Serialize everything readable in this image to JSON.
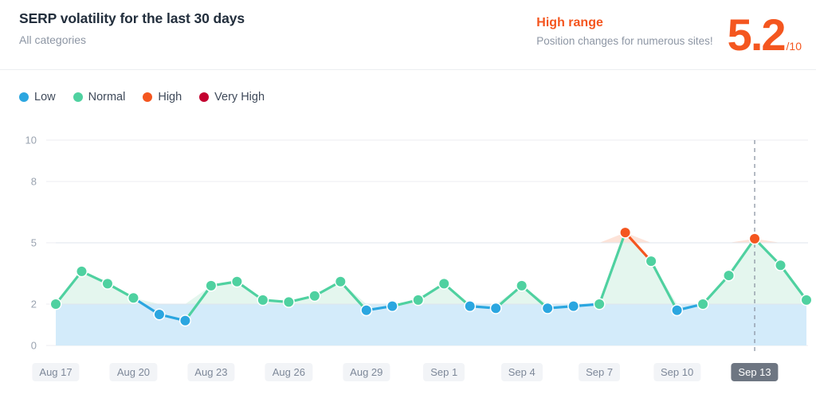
{
  "header": {
    "title": "SERP volatility for the last 30 days",
    "subtitle": "All categories",
    "range_title": "High range",
    "range_description": "Position changes for numerous sites!",
    "score_value": "5.2",
    "score_max": "/10"
  },
  "legend": [
    {
      "label": "Low",
      "color": "#2ba6e0"
    },
    {
      "label": "Normal",
      "color": "#4fd1a0"
    },
    {
      "label": "High",
      "color": "#f4561f"
    },
    {
      "label": "Very High",
      "color": "#c3002f"
    }
  ],
  "colors": {
    "low": "#2ba6e0",
    "normal": "#4fd1a0",
    "high": "#f4561f",
    "very_high": "#c3002f",
    "low_fill": "#d3ebfa",
    "normal_fill": "#e4f6ee",
    "high_fill": "#fde3d8",
    "grid": "#eceef1",
    "marker_line": "#8d96a4",
    "accent": "#f4561f"
  },
  "chart_data": {
    "type": "line",
    "title": "SERP volatility for the last 30 days",
    "subtitle": "All categories",
    "xlabel": "",
    "ylabel": "",
    "ylim": [
      0,
      10
    ],
    "yticks": [
      0,
      2,
      5,
      8,
      10
    ],
    "grid": true,
    "legend_position": "top-left",
    "bands": [
      {
        "name": "Low",
        "min": 0,
        "max": 2,
        "color": "#2ba6e0"
      },
      {
        "name": "Normal",
        "min": 2,
        "max": 5,
        "color": "#4fd1a0"
      },
      {
        "name": "High",
        "min": 5,
        "max": 8,
        "color": "#f4561f"
      },
      {
        "name": "Very High",
        "min": 8,
        "max": 10,
        "color": "#c3002f"
      }
    ],
    "marker": {
      "x": "Sep 13",
      "value": 5.2,
      "style": "dashed-vertical"
    },
    "x": [
      "Aug 17",
      "Aug 18",
      "Aug 19",
      "Aug 20",
      "Aug 21",
      "Aug 22",
      "Aug 23",
      "Aug 24",
      "Aug 25",
      "Aug 26",
      "Aug 27",
      "Aug 28",
      "Aug 29",
      "Aug 30",
      "Aug 31",
      "Sep 1",
      "Sep 2",
      "Sep 3",
      "Sep 4",
      "Sep 5",
      "Sep 6",
      "Sep 7",
      "Sep 8",
      "Sep 9",
      "Sep 10",
      "Sep 11",
      "Sep 12",
      "Sep 13",
      "Sep 14",
      "Sep 15"
    ],
    "values": [
      2.0,
      3.6,
      3.0,
      2.3,
      1.5,
      1.2,
      2.9,
      3.1,
      2.2,
      2.1,
      2.4,
      3.1,
      1.7,
      1.9,
      2.2,
      3.0,
      1.9,
      1.8,
      2.9,
      1.8,
      1.9,
      2.0,
      5.5,
      4.1,
      1.7,
      2.0,
      3.4,
      5.2,
      3.9,
      2.2
    ],
    "tick_labels": [
      "Aug 17",
      "Aug 20",
      "Aug 23",
      "Aug 26",
      "Aug 29",
      "Sep 1",
      "Sep 4",
      "Sep 7",
      "Sep 10",
      "Sep 13"
    ],
    "selected_tick": "Sep 13"
  }
}
